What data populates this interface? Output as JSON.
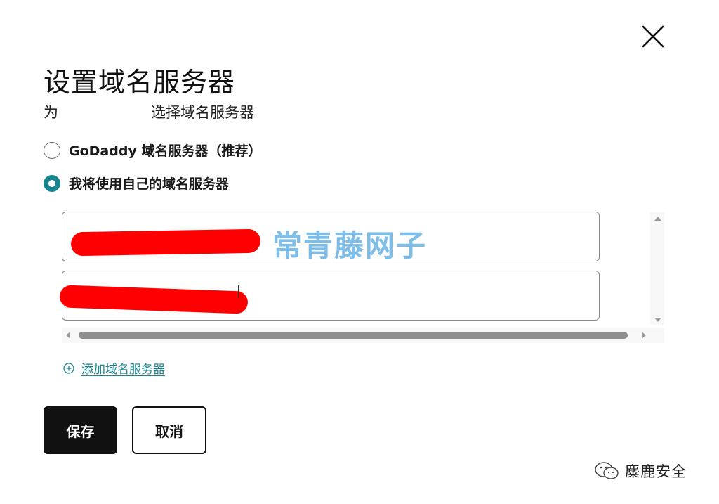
{
  "dialog": {
    "title": "设置域名服务器",
    "subtitle_prefix": "为",
    "subtitle_suffix": "选择域名服务器",
    "close_icon": "close-icon"
  },
  "options": [
    {
      "label": "GoDaddy 域名服务器（推荐）",
      "selected": false
    },
    {
      "label": "我将使用自己的域名服务器",
      "selected": true
    }
  ],
  "nameservers": [
    {
      "value": "",
      "redacted": true
    },
    {
      "value": "",
      "redacted": true
    }
  ],
  "add_nameserver": {
    "label": "添加域名服务器",
    "icon": "plus-circle-icon"
  },
  "buttons": {
    "save": "保存",
    "cancel": "取消"
  },
  "watermarks": {
    "center": "常青藤网子",
    "corner": "麋鹿安全",
    "corner_icon": "wechat-icon"
  },
  "colors": {
    "accent": "#17848e",
    "primary_button": "#111111",
    "redaction": "#ff0000"
  }
}
